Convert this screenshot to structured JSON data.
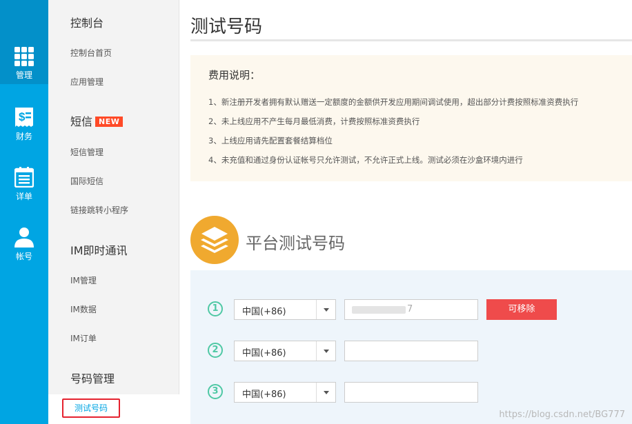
{
  "rail": {
    "items": [
      {
        "label": "管理",
        "icon": "grid-icon"
      },
      {
        "label": "财务",
        "icon": "finance-icon"
      },
      {
        "label": "详单",
        "icon": "calendar-list-icon"
      },
      {
        "label": "帐号",
        "icon": "user-icon"
      }
    ]
  },
  "sidebar": {
    "console": {
      "title": "控制台",
      "items": [
        "控制台首页",
        "应用管理"
      ]
    },
    "sms": {
      "title": "短信",
      "badge": "NEW",
      "items": [
        "短信管理",
        "国际短信",
        "链接跳转小程序"
      ]
    },
    "im": {
      "title": "IM即时通讯",
      "items": [
        "IM管理",
        "IM数据",
        "IM订单"
      ]
    },
    "numbers": {
      "title": "号码管理",
      "active_item": "测试号码"
    }
  },
  "page": {
    "title": "测试号码"
  },
  "notice": {
    "title": "费用说明：",
    "lines": [
      "1、新注册开发者拥有默认赠送一定额度的金额供开发应用期间调试使用，超出部分计费按照标准资费执行",
      "2、未上线应用不产生每月最低消费，计费按照标准资费执行",
      "3、上线应用请先配置套餐结算档位",
      "4、未充值和通过身份认证帐号只允许测试，不允许正式上线。测试必须在沙盒环境内进行"
    ]
  },
  "platform": {
    "title": "平台测试号码",
    "rows": [
      {
        "num": "1",
        "country": "中国(+86)",
        "phone_visible_digit": "7"
      },
      {
        "num": "2",
        "country": "中国(+86)",
        "phone_visible_digit": ""
      },
      {
        "num": "3",
        "country": "中国(+86)",
        "phone_visible_digit": ""
      }
    ],
    "remove_button": "可移除"
  },
  "watermark": "https://blog.csdn.net/BG777",
  "colors": {
    "rail": "#00a5e3",
    "accent_red": "#ef4b4b",
    "badge": "#ff4a27",
    "circle": "#4fc8a4",
    "notice_bg": "#fdf8ee"
  }
}
